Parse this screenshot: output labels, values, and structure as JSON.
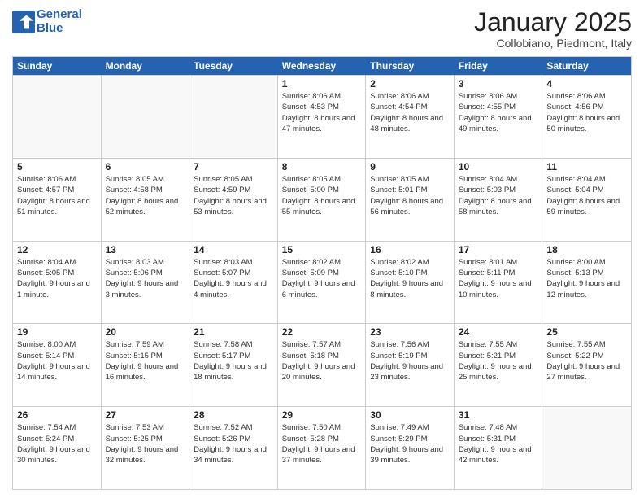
{
  "logo": {
    "line1": "General",
    "line2": "Blue"
  },
  "title": "January 2025",
  "subtitle": "Collobiano, Piedmont, Italy",
  "days_of_week": [
    "Sunday",
    "Monday",
    "Tuesday",
    "Wednesday",
    "Thursday",
    "Friday",
    "Saturday"
  ],
  "weeks": [
    [
      {
        "day": "",
        "info": ""
      },
      {
        "day": "",
        "info": ""
      },
      {
        "day": "",
        "info": ""
      },
      {
        "day": "1",
        "info": "Sunrise: 8:06 AM\nSunset: 4:53 PM\nDaylight: 8 hours and 47 minutes."
      },
      {
        "day": "2",
        "info": "Sunrise: 8:06 AM\nSunset: 4:54 PM\nDaylight: 8 hours and 48 minutes."
      },
      {
        "day": "3",
        "info": "Sunrise: 8:06 AM\nSunset: 4:55 PM\nDaylight: 8 hours and 49 minutes."
      },
      {
        "day": "4",
        "info": "Sunrise: 8:06 AM\nSunset: 4:56 PM\nDaylight: 8 hours and 50 minutes."
      }
    ],
    [
      {
        "day": "5",
        "info": "Sunrise: 8:06 AM\nSunset: 4:57 PM\nDaylight: 8 hours and 51 minutes."
      },
      {
        "day": "6",
        "info": "Sunrise: 8:05 AM\nSunset: 4:58 PM\nDaylight: 8 hours and 52 minutes."
      },
      {
        "day": "7",
        "info": "Sunrise: 8:05 AM\nSunset: 4:59 PM\nDaylight: 8 hours and 53 minutes."
      },
      {
        "day": "8",
        "info": "Sunrise: 8:05 AM\nSunset: 5:00 PM\nDaylight: 8 hours and 55 minutes."
      },
      {
        "day": "9",
        "info": "Sunrise: 8:05 AM\nSunset: 5:01 PM\nDaylight: 8 hours and 56 minutes."
      },
      {
        "day": "10",
        "info": "Sunrise: 8:04 AM\nSunset: 5:03 PM\nDaylight: 8 hours and 58 minutes."
      },
      {
        "day": "11",
        "info": "Sunrise: 8:04 AM\nSunset: 5:04 PM\nDaylight: 8 hours and 59 minutes."
      }
    ],
    [
      {
        "day": "12",
        "info": "Sunrise: 8:04 AM\nSunset: 5:05 PM\nDaylight: 9 hours and 1 minute."
      },
      {
        "day": "13",
        "info": "Sunrise: 8:03 AM\nSunset: 5:06 PM\nDaylight: 9 hours and 3 minutes."
      },
      {
        "day": "14",
        "info": "Sunrise: 8:03 AM\nSunset: 5:07 PM\nDaylight: 9 hours and 4 minutes."
      },
      {
        "day": "15",
        "info": "Sunrise: 8:02 AM\nSunset: 5:09 PM\nDaylight: 9 hours and 6 minutes."
      },
      {
        "day": "16",
        "info": "Sunrise: 8:02 AM\nSunset: 5:10 PM\nDaylight: 9 hours and 8 minutes."
      },
      {
        "day": "17",
        "info": "Sunrise: 8:01 AM\nSunset: 5:11 PM\nDaylight: 9 hours and 10 minutes."
      },
      {
        "day": "18",
        "info": "Sunrise: 8:00 AM\nSunset: 5:13 PM\nDaylight: 9 hours and 12 minutes."
      }
    ],
    [
      {
        "day": "19",
        "info": "Sunrise: 8:00 AM\nSunset: 5:14 PM\nDaylight: 9 hours and 14 minutes."
      },
      {
        "day": "20",
        "info": "Sunrise: 7:59 AM\nSunset: 5:15 PM\nDaylight: 9 hours and 16 minutes."
      },
      {
        "day": "21",
        "info": "Sunrise: 7:58 AM\nSunset: 5:17 PM\nDaylight: 9 hours and 18 minutes."
      },
      {
        "day": "22",
        "info": "Sunrise: 7:57 AM\nSunset: 5:18 PM\nDaylight: 9 hours and 20 minutes."
      },
      {
        "day": "23",
        "info": "Sunrise: 7:56 AM\nSunset: 5:19 PM\nDaylight: 9 hours and 23 minutes."
      },
      {
        "day": "24",
        "info": "Sunrise: 7:55 AM\nSunset: 5:21 PM\nDaylight: 9 hours and 25 minutes."
      },
      {
        "day": "25",
        "info": "Sunrise: 7:55 AM\nSunset: 5:22 PM\nDaylight: 9 hours and 27 minutes."
      }
    ],
    [
      {
        "day": "26",
        "info": "Sunrise: 7:54 AM\nSunset: 5:24 PM\nDaylight: 9 hours and 30 minutes."
      },
      {
        "day": "27",
        "info": "Sunrise: 7:53 AM\nSunset: 5:25 PM\nDaylight: 9 hours and 32 minutes."
      },
      {
        "day": "28",
        "info": "Sunrise: 7:52 AM\nSunset: 5:26 PM\nDaylight: 9 hours and 34 minutes."
      },
      {
        "day": "29",
        "info": "Sunrise: 7:50 AM\nSunset: 5:28 PM\nDaylight: 9 hours and 37 minutes."
      },
      {
        "day": "30",
        "info": "Sunrise: 7:49 AM\nSunset: 5:29 PM\nDaylight: 9 hours and 39 minutes."
      },
      {
        "day": "31",
        "info": "Sunrise: 7:48 AM\nSunset: 5:31 PM\nDaylight: 9 hours and 42 minutes."
      },
      {
        "day": "",
        "info": ""
      }
    ]
  ]
}
